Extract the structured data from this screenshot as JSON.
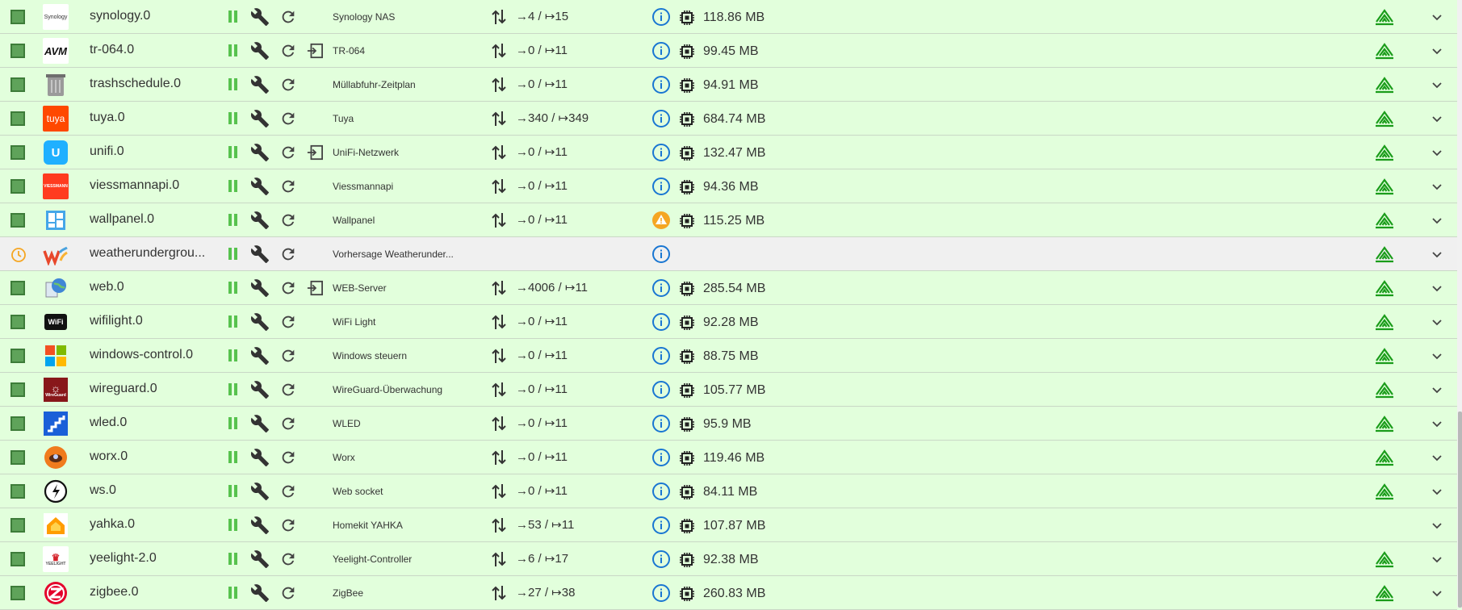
{
  "colors": {
    "row_bg": "#e2ffdc",
    "row_bg_disabled": "#f0f0f0",
    "accent_green": "#57c24e",
    "info_blue": "#1976d2",
    "warning_orange": "#f5a623"
  },
  "adapters": [
    {
      "name": "synology.0",
      "title": "Synology NAS",
      "events": "→4 / ↦15",
      "memory": "118.86 MB",
      "logo": "synology-logo",
      "status": "enabled",
      "link": false,
      "info": "info",
      "repo": true
    },
    {
      "name": "tr-064.0",
      "title": "TR-064",
      "events": "→0 / ↦11",
      "memory": "99.45 MB",
      "logo": "avm-logo",
      "status": "enabled",
      "link": true,
      "info": "info",
      "repo": true
    },
    {
      "name": "trashschedule.0",
      "title": "Müllabfuhr-Zeitplan",
      "events": "→0 / ↦11",
      "memory": "94.91 MB",
      "logo": "trash-can-logo",
      "status": "enabled",
      "link": false,
      "info": "info",
      "repo": true
    },
    {
      "name": "tuya.0",
      "title": "Tuya",
      "events": "→340 / ↦349",
      "memory": "684.74 MB",
      "logo": "tuya-logo",
      "status": "enabled",
      "link": false,
      "info": "info",
      "repo": true
    },
    {
      "name": "unifi.0",
      "title": "UniFi-Netzwerk",
      "events": "→0 / ↦11",
      "memory": "132.47 MB",
      "logo": "unifi-logo",
      "status": "enabled",
      "link": true,
      "info": "info",
      "repo": true
    },
    {
      "name": "viessmannapi.0",
      "title": "Viessmannapi",
      "events": "→0 / ↦11",
      "memory": "94.36 MB",
      "logo": "viessmann-logo",
      "status": "enabled",
      "link": false,
      "info": "info",
      "repo": true
    },
    {
      "name": "wallpanel.0",
      "title": "Wallpanel",
      "events": "→0 / ↦11",
      "memory": "115.25 MB",
      "logo": "wallpanel-logo",
      "status": "enabled",
      "link": false,
      "info": "warning",
      "repo": true
    },
    {
      "name": "weatherundergrou...",
      "title": "Vorhersage Weatherunder...",
      "events": "",
      "memory": "",
      "logo": "weatherunderground-logo",
      "status": "scheduled",
      "link": false,
      "info": "info",
      "repo": true
    },
    {
      "name": "web.0",
      "title": "WEB-Server",
      "events": "→4006 / ↦11",
      "memory": "285.54 MB",
      "logo": "web-globe-logo",
      "status": "enabled",
      "link": true,
      "info": "info",
      "repo": true
    },
    {
      "name": "wifilight.0",
      "title": "WiFi Light",
      "events": "→0 / ↦11",
      "memory": "92.28 MB",
      "logo": "wifi-logo",
      "status": "enabled",
      "link": false,
      "info": "info",
      "repo": true
    },
    {
      "name": "windows-control.0",
      "title": "Windows steuern",
      "events": "→0 / ↦11",
      "memory": "88.75 MB",
      "logo": "windows-logo",
      "status": "enabled",
      "link": false,
      "info": "info",
      "repo": true
    },
    {
      "name": "wireguard.0",
      "title": "WireGuard-Überwachung",
      "events": "→0 / ↦11",
      "memory": "105.77 MB",
      "logo": "wireguard-logo",
      "status": "enabled",
      "link": false,
      "info": "info",
      "repo": true
    },
    {
      "name": "wled.0",
      "title": "WLED",
      "events": "→0 / ↦11",
      "memory": "95.9 MB",
      "logo": "wled-logo",
      "status": "enabled",
      "link": false,
      "info": "info",
      "repo": true
    },
    {
      "name": "worx.0",
      "title": "Worx",
      "events": "→0 / ↦11",
      "memory": "119.46 MB",
      "logo": "worx-logo",
      "status": "enabled",
      "link": false,
      "info": "info",
      "repo": true
    },
    {
      "name": "ws.0",
      "title": "Web socket",
      "events": "→0 / ↦11",
      "memory": "84.11 MB",
      "logo": "websocket-logo",
      "status": "enabled",
      "link": false,
      "info": "info",
      "repo": true
    },
    {
      "name": "yahka.0",
      "title": "Homekit YAHKA",
      "events": "→53 / ↦11",
      "memory": "107.87 MB",
      "logo": "homekit-logo",
      "status": "enabled",
      "link": false,
      "info": "info",
      "repo": false
    },
    {
      "name": "yeelight-2.0",
      "title": "Yeelight-Controller",
      "events": "→6 / ↦17",
      "memory": "92.38 MB",
      "logo": "yeelight-logo",
      "status": "enabled",
      "link": false,
      "info": "info",
      "repo": true
    },
    {
      "name": "zigbee.0",
      "title": "ZigBee",
      "events": "→27 / ↦38",
      "memory": "260.83 MB",
      "logo": "zigbee-logo",
      "status": "enabled",
      "link": false,
      "info": "info",
      "repo": true
    }
  ]
}
